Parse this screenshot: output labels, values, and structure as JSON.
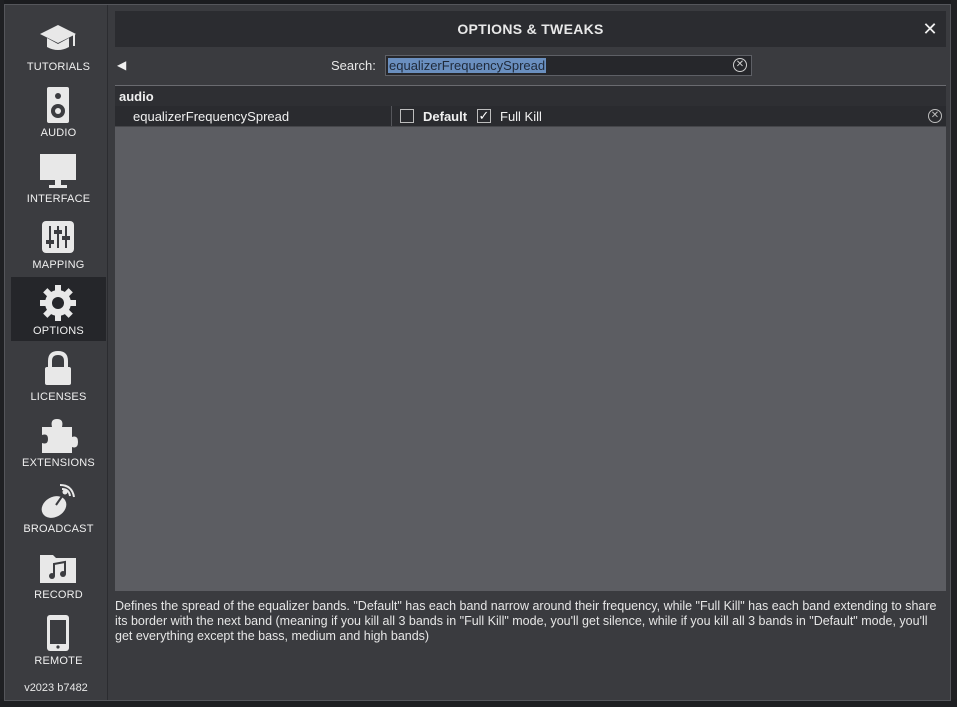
{
  "window": {
    "title": "OPTIONS & TWEAKS"
  },
  "sidebar": {
    "items": [
      {
        "label": "TUTORIALS",
        "icon": "graduation-cap-icon"
      },
      {
        "label": "AUDIO",
        "icon": "speaker-icon"
      },
      {
        "label": "INTERFACE",
        "icon": "monitor-icon"
      },
      {
        "label": "MAPPING",
        "icon": "sliders-icon"
      },
      {
        "label": "OPTIONS",
        "icon": "gear-icon",
        "active": true
      },
      {
        "label": "LICENSES",
        "icon": "lock-icon"
      },
      {
        "label": "EXTENSIONS",
        "icon": "puzzle-icon"
      },
      {
        "label": "BROADCAST",
        "icon": "satellite-dish-icon"
      },
      {
        "label": "RECORD",
        "icon": "music-folder-icon"
      },
      {
        "label": "REMOTE",
        "icon": "phone-icon"
      }
    ],
    "version": "v2023 b7482"
  },
  "search": {
    "label": "Search:",
    "value": "equalizerFrequencySpread"
  },
  "options": {
    "group": "audio",
    "rows": [
      {
        "name": "equalizerFrequencySpread",
        "choices": [
          {
            "label": "Default",
            "checked": false
          },
          {
            "label": "Full Kill",
            "checked": true
          }
        ]
      }
    ]
  },
  "description": "Defines the spread of the equalizer bands. \"Default\" has each band narrow around their frequency, while \"Full Kill\" has each band extending to share its border with the next band (meaning if you kill all 3 bands in \"Full Kill\" mode, you'll get silence, while if you kill all 3 bands in \"Default\" mode, you'll get everything except the bass, medium and high bands)",
  "colors": {
    "accent_selection": "#6a8fbf",
    "window_bg": "#3a3b3f",
    "panel_bg": "#5c5d62"
  }
}
